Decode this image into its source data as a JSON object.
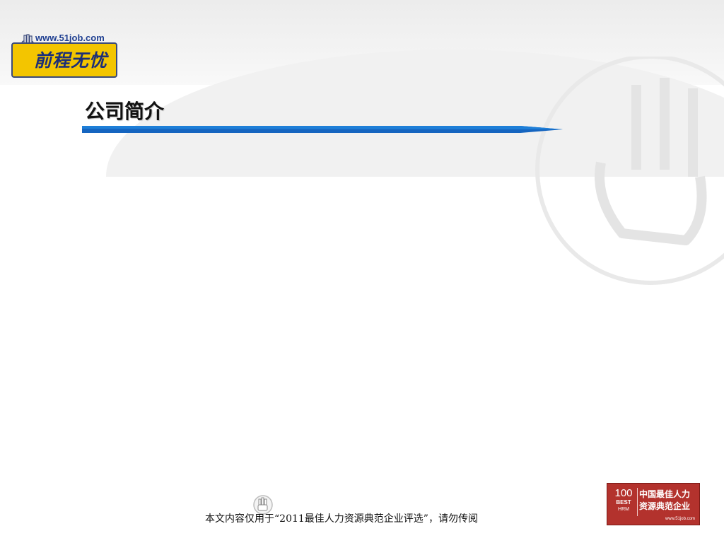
{
  "logo": {
    "site_url": "www.51job.com",
    "brand": "前程无忧"
  },
  "title": "公司简介",
  "footer": {
    "notice": "本文内容仅用于“2011最佳人力资源典范企业评选”，请勿传阅"
  },
  "award": {
    "number": "100",
    "best": "BEST",
    "hrm": "HRM",
    "line1": "中国最佳人力",
    "line2": "资源典范企业",
    "url": "www.51job.com"
  },
  "colors": {
    "accent_blue": "#1565c0",
    "logo_yellow": "#f3c500",
    "award_red": "#b3322d"
  }
}
